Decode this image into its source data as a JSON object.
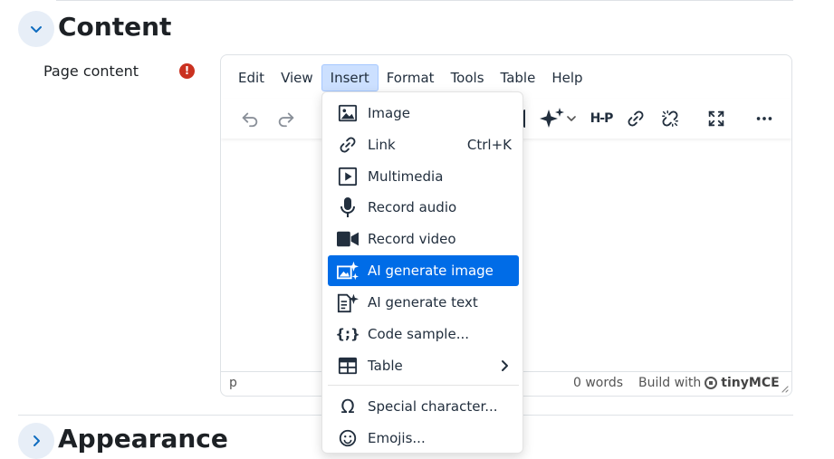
{
  "section": {
    "title": "Content",
    "field_label": "Page content",
    "required_mark": "!",
    "next_title": "Appearance"
  },
  "editor": {
    "menubar": [
      "Edit",
      "View",
      "Insert",
      "Format",
      "Tools",
      "Table",
      "Help"
    ],
    "active_menu": "Insert",
    "toolbar_icons": [
      "undo-icon",
      "redo-icon",
      "record-video-icon",
      "ai-sparkles-icon",
      "h5p-icon",
      "link-icon",
      "unlink-icon",
      "fullscreen-icon",
      "more-icon"
    ],
    "h5p_text": "H-P",
    "statusbar": {
      "path": "p",
      "words": "0 words",
      "build_with": "Build with",
      "brand": "tinyMCE"
    }
  },
  "insert_menu": {
    "items": [
      {
        "label": "Image",
        "icon": "image-icon",
        "shortcut": ""
      },
      {
        "label": "Link",
        "icon": "link-icon",
        "shortcut": "Ctrl+K"
      },
      {
        "label": "Multimedia",
        "icon": "multimedia-icon",
        "shortcut": ""
      },
      {
        "label": "Record audio",
        "icon": "microphone-icon",
        "shortcut": ""
      },
      {
        "label": "Record video",
        "icon": "video-camera-icon",
        "shortcut": ""
      },
      {
        "label": "AI generate image",
        "icon": "ai-image-icon",
        "shortcut": "",
        "highlighted": true
      },
      {
        "label": "AI generate text",
        "icon": "ai-text-icon",
        "shortcut": ""
      },
      {
        "label": "Code sample...",
        "icon": "code-sample-icon",
        "shortcut": ""
      },
      {
        "label": "Table",
        "icon": "table-icon",
        "shortcut": "",
        "submenu": true
      },
      {
        "label": "Special character...",
        "icon": "omega-icon",
        "shortcut": ""
      },
      {
        "label": "Emojis...",
        "icon": "emoji-icon",
        "shortcut": ""
      }
    ]
  },
  "colors": {
    "highlight": "#006ce7",
    "active_menu_bg": "#cce0ff",
    "required": "#ca3120",
    "toggle_bg": "#e7eef7",
    "toggle_chevron": "#0f6cbf"
  }
}
